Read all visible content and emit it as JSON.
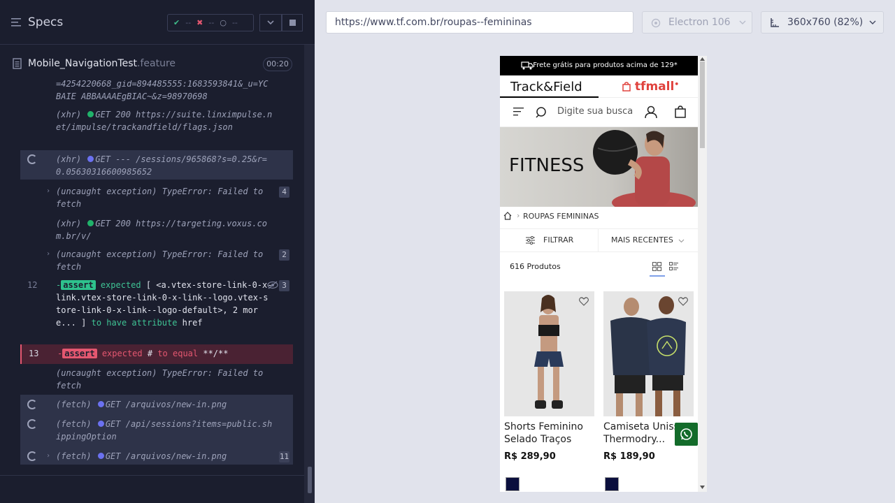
{
  "runner": {
    "specs_title": "Specs",
    "stats": {
      "passed": "--",
      "failed": "--",
      "pending": "--"
    },
    "file": {
      "name": "Mobile_NavigationTest",
      "ext": ".feature",
      "duration": "00:20"
    },
    "log": [
      {
        "text": "=4254220668_gid=894485555:1683593841&_u=YCBAIE ABBAAAAEgBIAC~&z=98970698"
      },
      {
        "text_prefix": "(xhr)",
        "text_status": "GET 200",
        "text": "https://suite.linximpulse.net/impulse/trackandfield/flags.json"
      },
      {
        "text_prefix": "(xhr)",
        "text_status": "GET ---",
        "text": "/sessions/965868?s=0.25&r=0.05630316600985652"
      },
      {
        "text_prefix": "(uncaught exception)",
        "text": "TypeError: Failed to fetch",
        "count": "4"
      },
      {
        "text_prefix": "(xhr)",
        "text_status": "GET 200",
        "text": "https://targeting.voxus.com.br/v/"
      },
      {
        "text_prefix": "(uncaught exception)",
        "text": "TypeError: Failed to fetch",
        "count": "2"
      },
      {
        "num": "12",
        "badge": "assert",
        "text_a": "expected",
        "text_b": "[ <a.vtex-store-link-0-x-link.vtex-store-link-0-x-link--logo.vtex-store-link-0-x-link--logo-default>, 2 more... ]",
        "text_c": "to have attribute",
        "text_d": "href",
        "count": "3"
      },
      {
        "num": "13",
        "badge": "assert",
        "text_a": "expected",
        "text_b": "#",
        "text_c": "to equal",
        "text_d": "**/**"
      },
      {
        "text_prefix": "(uncaught exception)",
        "text": "TypeError: Failed to fetch"
      },
      {
        "text_prefix": "(fetch)",
        "text_status": "GET",
        "text": "/arquivos/new-in.png"
      },
      {
        "text_prefix": "(fetch)",
        "text_status": "GET",
        "text": "/api/sessions?items=public.shippingOption"
      },
      {
        "text_prefix": "(fetch)",
        "text_status": "GET",
        "text": "/arquivos/new-in.png",
        "count": "11"
      }
    ]
  },
  "aut": {
    "url": "https://www.tf.com.br/roupas--femininas",
    "browser": "Electron 106",
    "viewport": "360x760 (82%)"
  },
  "site": {
    "shipping": "Frete grátis para produtos acima de 129*",
    "tab_main": "Track&Field",
    "tab_mall": "tfmall",
    "search_placeholder": "Digite sua busca",
    "hero_title": "FITNESS",
    "breadcrumb": "ROUPAS FEMININAS",
    "filter_label": "FILTRAR",
    "sort_label": "MAIS RECENTES",
    "product_count": "616 Produtos",
    "products": [
      {
        "name": "Shorts Feminino Selado Traços",
        "price": "R$ 289,90"
      },
      {
        "name": "Camiseta Unissex Thermodry...",
        "price": "R$ 189,90"
      }
    ]
  }
}
